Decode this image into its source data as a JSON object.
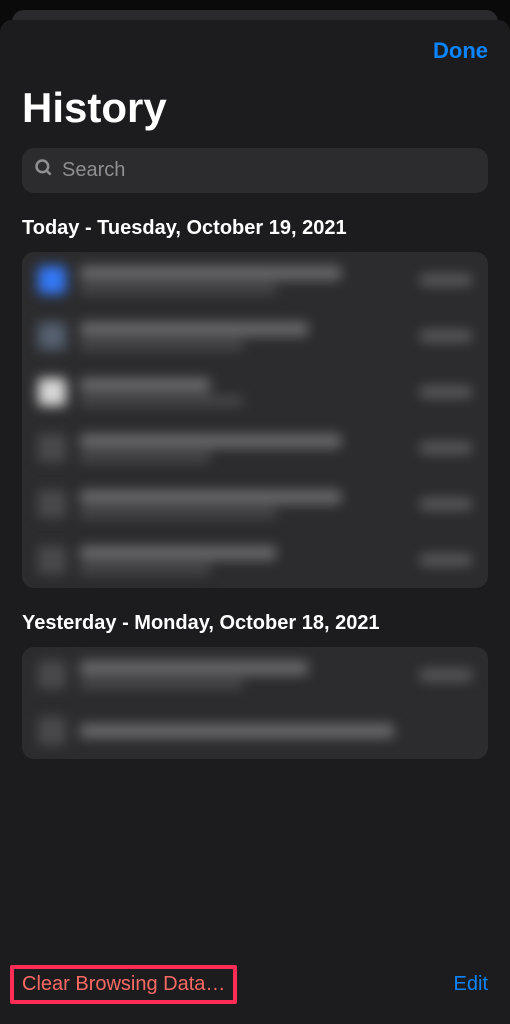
{
  "header": {
    "done_label": "Done"
  },
  "title": "History",
  "search": {
    "placeholder": "Search"
  },
  "sections": [
    {
      "label": "Today - Tuesday, October 19, 2021"
    },
    {
      "label": "Yesterday - Monday, October 18, 2021"
    }
  ],
  "bottom": {
    "clear_label": "Clear Browsing Data…",
    "edit_label": "Edit"
  },
  "colors": {
    "accent": "#0a84ff",
    "destructive": "#ff6964",
    "highlight_border": "#ff2d55",
    "background": "#1c1c1e",
    "surface": "#2c2c2e"
  }
}
